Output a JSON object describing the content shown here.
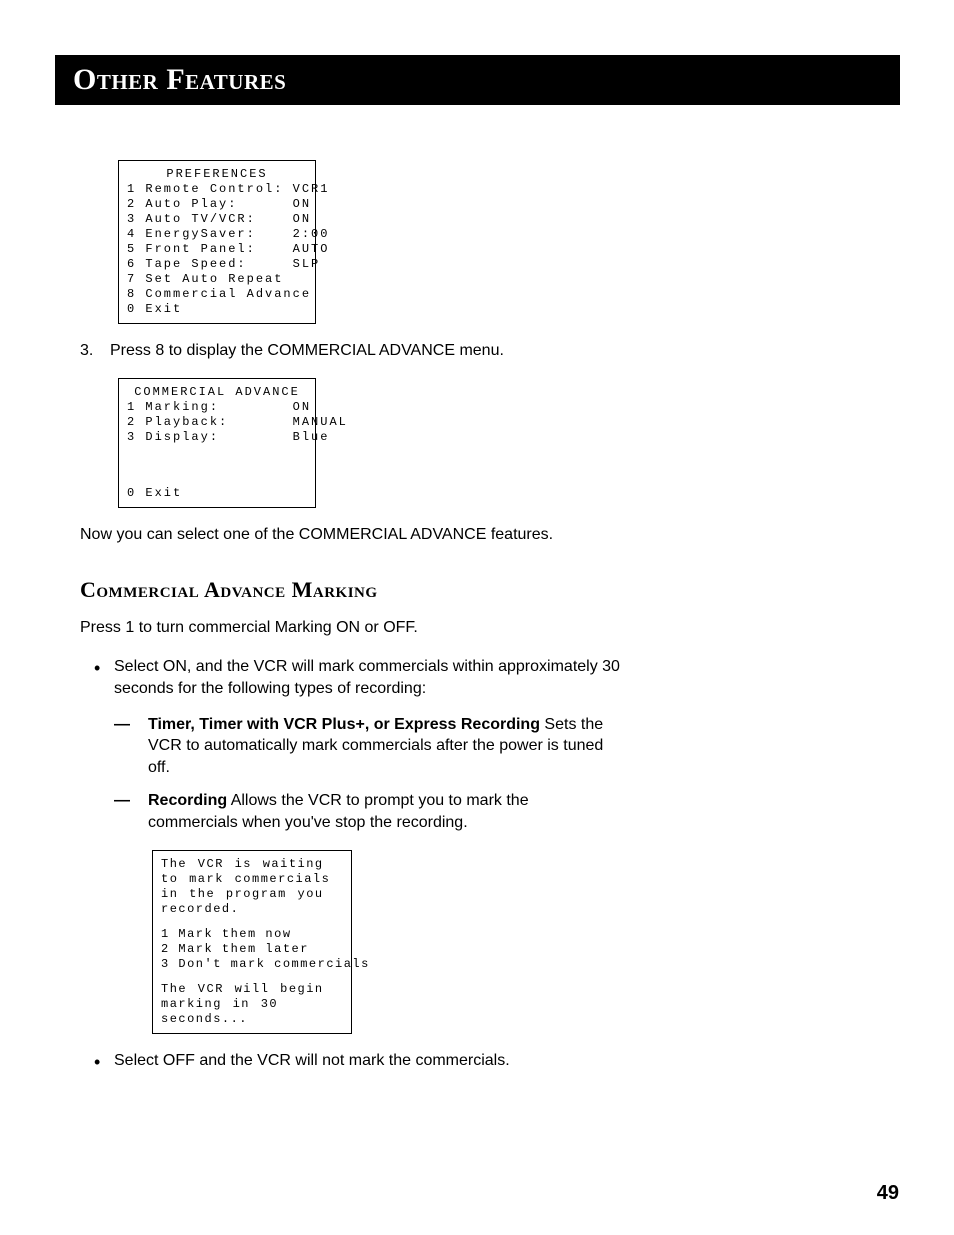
{
  "header": {
    "title": "Other Features"
  },
  "menu1": {
    "title": "PREFERENCES",
    "rows": [
      {
        "n": "1",
        "label": "Remote Control:",
        "val": "VCR1"
      },
      {
        "n": "2",
        "label": "Auto Play:",
        "val": "ON"
      },
      {
        "n": "3",
        "label": "Auto TV/VCR:",
        "val": "ON"
      },
      {
        "n": "4",
        "label": "EnergySaver:",
        "val": "2:00"
      },
      {
        "n": "5",
        "label": "Front Panel:",
        "val": "AUTO"
      },
      {
        "n": "6",
        "label": "Tape Speed:",
        "val": "SLP"
      },
      {
        "n": "7",
        "label": "Set Auto Repeat",
        "val": ""
      },
      {
        "n": "8",
        "label": "Commercial Advance",
        "val": ""
      },
      {
        "n": "0",
        "label": "Exit",
        "val": ""
      }
    ]
  },
  "step3": {
    "num": "3.",
    "text": "Press 8 to display the COMMERCIAL ADVANCE menu."
  },
  "menu2": {
    "title": "COMMERCIAL ADVANCE",
    "rows": [
      {
        "n": "1",
        "label": "Marking:",
        "val": "ON"
      },
      {
        "n": "2",
        "label": "Playback:",
        "val": "MANUAL"
      },
      {
        "n": "3",
        "label": "Display:",
        "val": "Blue"
      }
    ],
    "exit": {
      "n": "0",
      "label": "Exit"
    }
  },
  "after_menu2": "Now you can select one of the COMMERCIAL ADVANCE features.",
  "section": {
    "heading": "Commercial Advance Marking",
    "intro": "Press 1 to turn commercial Marking ON or OFF.",
    "bullet1": "Select ON, and the VCR will mark commercials within approximately 30 seconds for the following types of recording:",
    "dash1_bold": "Timer, Timer with VCR Plus+, or Express Recording",
    "dash1_rest": "   Sets the VCR to automatically mark commercials after the power is tuned off.",
    "dash2_bold": "Recording",
    "dash2_rest": "   Allows the VCR to prompt you to mark the commercials when you've stop the recording.",
    "bullet2": "Select OFF and the VCR will not mark the commercials."
  },
  "menu3": {
    "p1": "The VCR is waiting to mark commercials in the program you recorded.",
    "r1": "1 Mark them now",
    "r2": "2 Mark them later",
    "r3": "3 Don't mark commercials",
    "p2": "The VCR will begin marking in 30 seconds..."
  },
  "page_number": "49"
}
